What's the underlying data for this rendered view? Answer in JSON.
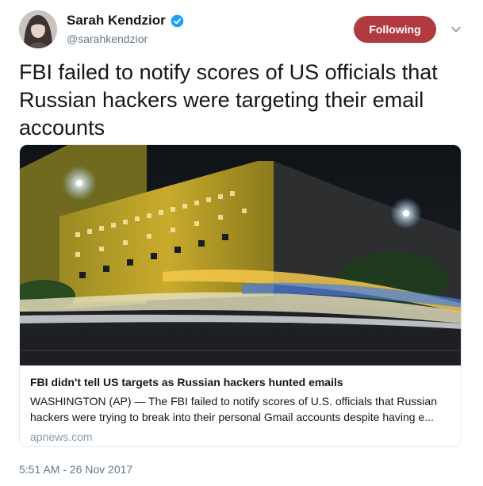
{
  "author": {
    "name": "Sarah Kendzior",
    "handle": "@sarahkendzior",
    "verified": true
  },
  "follow_button": {
    "label": "Following",
    "color": "#b03a3f"
  },
  "tweet": {
    "text": "FBI failed to notify scores of US officials that Russian hackers were targeting their email accounts",
    "timestamp": "5:51 AM - 26 Nov 2017"
  },
  "link_card": {
    "title": "FBI didn't tell US targets as Russian hackers hunted emails",
    "description_line1": "WASHINGTON (AP) — The FBI failed to notify scores of U.S. officials that Russian",
    "description_line2": "hackers were trying to break into their personal Gmail accounts despite having e...",
    "domain": "apnews.com",
    "image": "fbi-building-night-photo"
  },
  "icons": {
    "verified": "verified-badge-icon",
    "caret": "chevron-down-icon"
  }
}
